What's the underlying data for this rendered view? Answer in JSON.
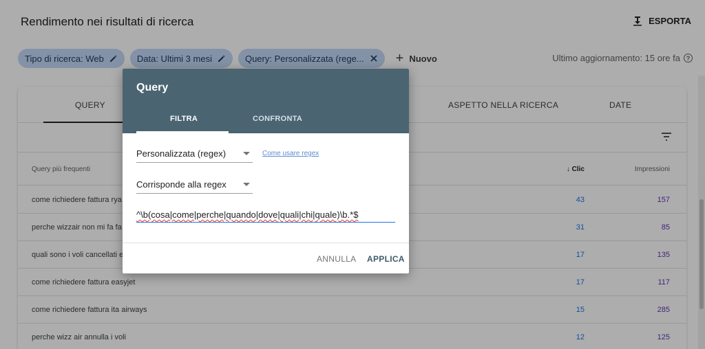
{
  "header": {
    "title": "Rendimento nei risultati di ricerca",
    "export_label": "ESPORTA"
  },
  "filters": {
    "chips": [
      {
        "label": "Tipo di ricerca: Web"
      },
      {
        "label": "Data: Ultimi 3 mesi"
      },
      {
        "label": "Query: Personalizzata (rege..."
      }
    ],
    "new_label": "Nuovo",
    "updated": "Ultimo aggiornamento: 15 ore fa"
  },
  "tabs": [
    "QUERY",
    "ASPETTO NELLA RICERCA",
    "DATE"
  ],
  "table": {
    "headers": {
      "query": "Query più frequenti",
      "clicks": "Clic",
      "impressions": "Impressioni"
    },
    "rows": [
      {
        "query": "come richiedere fattura rya",
        "clicks": "43",
        "impressions": "157"
      },
      {
        "query": "perche wizzair non mi fa fa",
        "clicks": "31",
        "impressions": "85"
      },
      {
        "query": "quali sono i voli cancellati e",
        "clicks": "17",
        "impressions": "135"
      },
      {
        "query": "come richiedere fattura easyjet",
        "clicks": "17",
        "impressions": "117"
      },
      {
        "query": "come richiedere fattura ita airways",
        "clicks": "15",
        "impressions": "285"
      },
      {
        "query": "perche wizz air annulla i voli",
        "clicks": "12",
        "impressions": "125"
      }
    ]
  },
  "dialog": {
    "title": "Query",
    "tabs": {
      "filter": "FILTRA",
      "compare": "CONFRONTA"
    },
    "type_select": "Personalizzata (regex)",
    "regex_help": "Come usare regex",
    "match_select": "Corrisponde alla regex",
    "regex_value": "^\\b(cosa|come|perche|quando|dove|quali|chi|quale)\\b.*$",
    "cancel": "ANNULLA",
    "apply": "APPLICA"
  },
  "colors": {
    "chip_bg": "#c2d7f5",
    "dialog_header": "#4a6472",
    "clicks": "#1a73e8",
    "impressions": "#5e35b1"
  }
}
